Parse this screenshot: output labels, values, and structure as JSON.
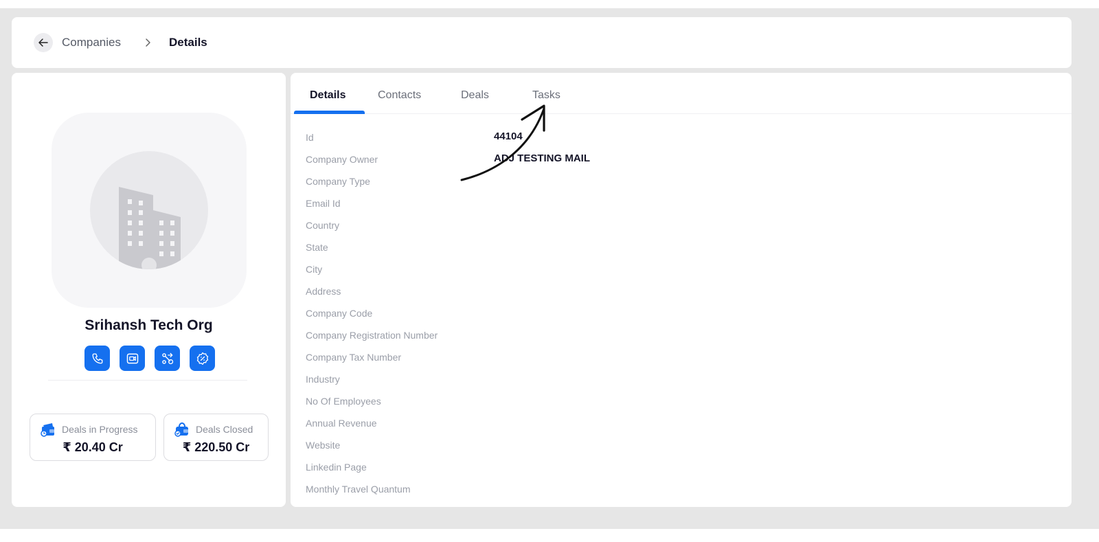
{
  "breadcrumb": {
    "parent": "Companies",
    "current": "Details"
  },
  "company": {
    "name": "Srihansh Tech Org"
  },
  "actions": [
    {
      "icon": "phone-icon"
    },
    {
      "icon": "video-call-icon"
    },
    {
      "icon": "route-icon"
    },
    {
      "icon": "verified-badge-icon"
    }
  ],
  "stats": {
    "in_progress": {
      "label": "Deals in Progress",
      "value": "₹ 20.40 Cr"
    },
    "closed": {
      "label": "Deals Closed",
      "value": "₹ 220.50 Cr"
    }
  },
  "tabs": [
    {
      "label": "Details",
      "active": true
    },
    {
      "label": "Contacts",
      "active": false
    },
    {
      "label": "Deals",
      "active": false
    },
    {
      "label": "Tasks",
      "active": false
    }
  ],
  "fields": [
    {
      "label": "Id",
      "value": "44104"
    },
    {
      "label": "Company Owner",
      "value": "ADJ TESTING MAIL"
    },
    {
      "label": "Company Type",
      "value": ""
    },
    {
      "label": "Email Id",
      "value": ""
    },
    {
      "label": "Country",
      "value": ""
    },
    {
      "label": "State",
      "value": ""
    },
    {
      "label": "City",
      "value": ""
    },
    {
      "label": "Address",
      "value": ""
    },
    {
      "label": "Company Code",
      "value": ""
    },
    {
      "label": "Company Registration Number",
      "value": ""
    },
    {
      "label": "Company Tax Number",
      "value": ""
    },
    {
      "label": "Industry",
      "value": ""
    },
    {
      "label": "No Of Employees",
      "value": ""
    },
    {
      "label": "Annual Revenue",
      "value": ""
    },
    {
      "label": "Website",
      "value": ""
    },
    {
      "label": "Linkedin Page",
      "value": ""
    },
    {
      "label": "Monthly Travel Quantum",
      "value": ""
    }
  ],
  "colors": {
    "accent": "#1570ef",
    "background": "#e6e6e6"
  }
}
